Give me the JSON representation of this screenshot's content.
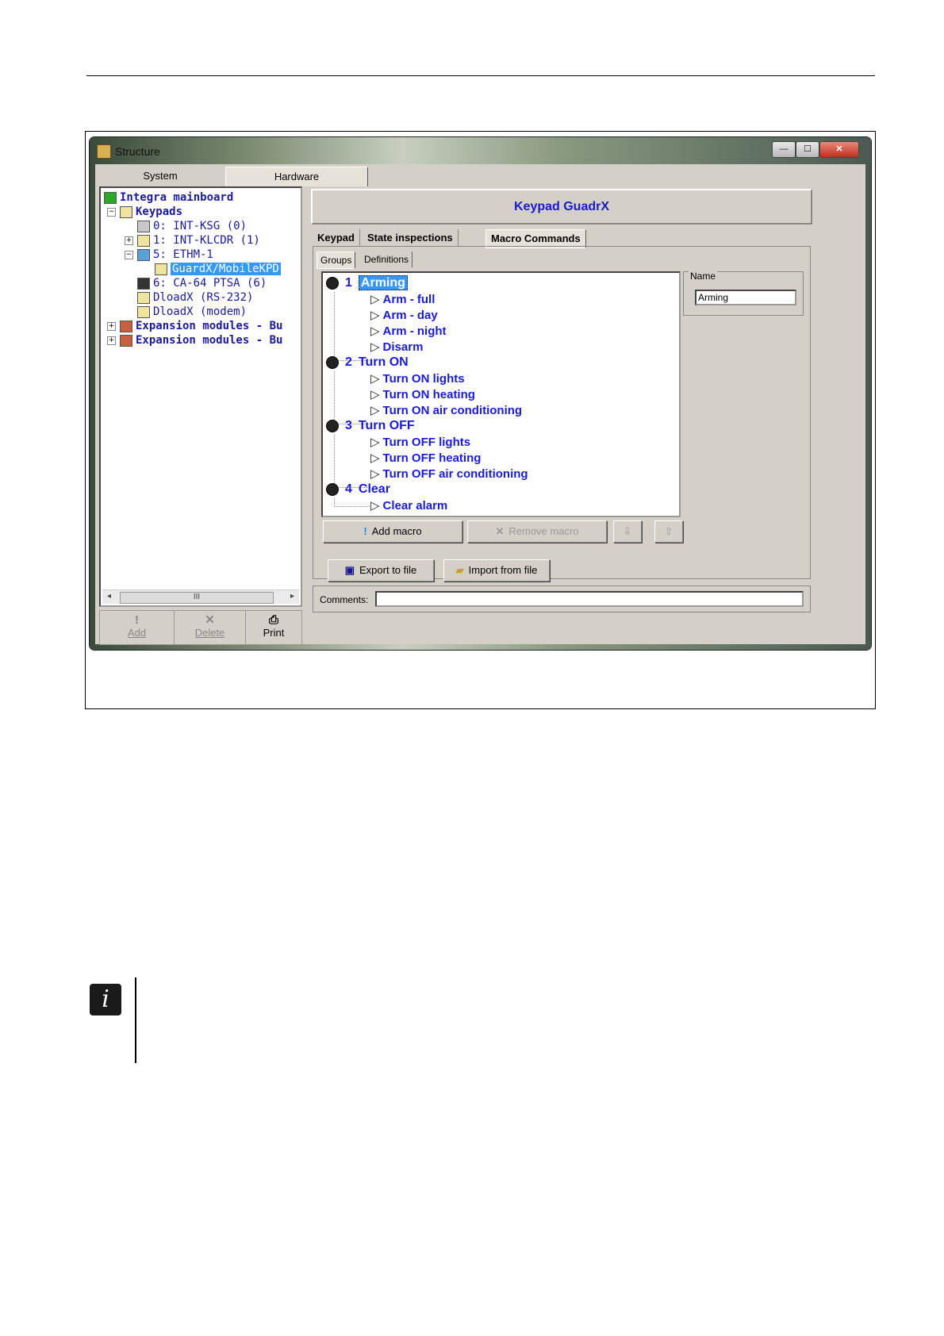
{
  "window": {
    "title": "Structure",
    "controls": {
      "minimize": "—",
      "maximize": "☐",
      "close": "✕"
    }
  },
  "main_tabs": [
    {
      "label": "System"
    },
    {
      "label": "Hardware"
    }
  ],
  "tree": {
    "items": [
      {
        "label": "Integra mainboard",
        "icon": "mainboard-icon"
      },
      {
        "label": "Keypads",
        "icon": "keypads-icon"
      },
      {
        "label": "0:  INT-KSG      (0)",
        "icon": "keypad-icon"
      },
      {
        "label": "1:  INT-KLCDR    (1)",
        "icon": "keypad-icon"
      },
      {
        "label": "5:  ETHM-1",
        "icon": "network-icon"
      },
      {
        "label": "GuardX/MobileKPD",
        "icon": "keypad-icon"
      },
      {
        "label": "6:  CA-64 PTSA   (6)",
        "icon": "traffic-light-icon"
      },
      {
        "label": "DloadX (RS-232)",
        "icon": "computer-icon"
      },
      {
        "label": "DloadX (modem)",
        "icon": "computer-icon"
      },
      {
        "label": "Expansion modules - Bu",
        "icon": "modules-icon"
      },
      {
        "label": "Expansion modules - Bu",
        "icon": "modules-icon"
      }
    ],
    "scroll_thumb": "III"
  },
  "left_buttons": {
    "add": "Add",
    "delete": "Delete",
    "print": "Print"
  },
  "right": {
    "header": "Keypad GuadrX",
    "tabs": [
      {
        "label": "Keypad"
      },
      {
        "label": "State inspections"
      },
      {
        "label": "Macro Commands"
      }
    ],
    "subtabs": [
      {
        "label": "Groups"
      },
      {
        "label": "Definitions"
      }
    ],
    "groups": [
      {
        "num": "1",
        "name": "Arming",
        "macros": [
          "Arm - full",
          "Arm - day",
          "Arm - night",
          "Disarm"
        ]
      },
      {
        "num": "2",
        "name": "Turn ON",
        "macros": [
          "Turn ON lights",
          "Turn ON heating",
          "Turn ON air conditioning"
        ]
      },
      {
        "num": "3",
        "name": "Turn OFF",
        "macros": [
          "Turn OFF lights",
          "Turn OFF heating",
          "Turn OFF air conditioning"
        ]
      },
      {
        "num": "4",
        "name": "Clear",
        "macros": [
          "Clear alarm"
        ]
      }
    ],
    "buttons": {
      "add_macro": "Add macro",
      "remove_macro": "Remove macro",
      "export": "Export to file",
      "import": "Import from file"
    },
    "name_panel": {
      "label": "Name",
      "value": "Arming"
    },
    "comments_label": "Comments:"
  },
  "note_icon": "i"
}
